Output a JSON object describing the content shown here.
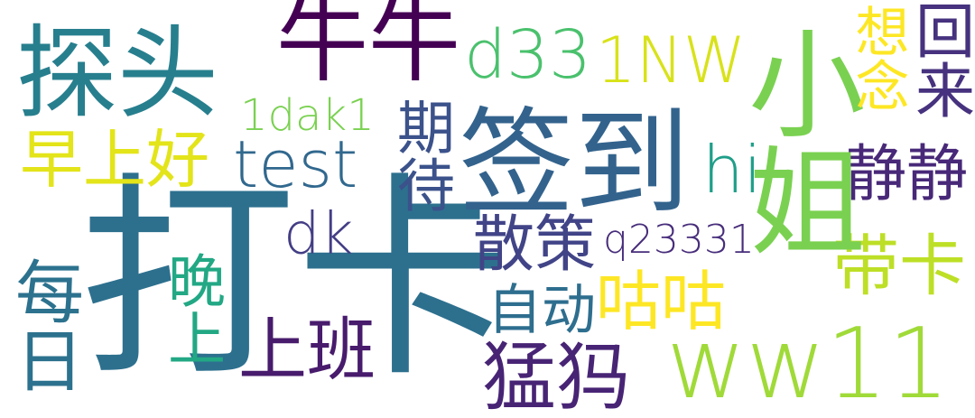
{
  "words": [
    {
      "id": "w-daka",
      "text": "打卡",
      "color": "#2d708e"
    },
    {
      "id": "w-qiandao",
      "text": "签到",
      "color": "#33638d"
    },
    {
      "id": "w-tantou",
      "text": "探头",
      "color": "#277f8e"
    },
    {
      "id": "w-niuniu",
      "text": "牛牛",
      "color": "#440154"
    },
    {
      "id": "w-xiaojie",
      "text": "小姐",
      "color": "#7ad151"
    },
    {
      "id": "w-ww11",
      "text": "ww11",
      "color": "#a0da39"
    },
    {
      "id": "w-d33",
      "text": "d33",
      "color": "#4ac16d"
    },
    {
      "id": "w-1nw",
      "text": "1NW",
      "color": "#d8e219"
    },
    {
      "id": "w-zaoshanghao",
      "text": "早上好",
      "color": "#e3e419"
    },
    {
      "id": "w-test",
      "text": "test",
      "color": "#31688e"
    },
    {
      "id": "w-1dak1",
      "text": "1dak1",
      "color": "#7ad151"
    },
    {
      "id": "w-qidai",
      "text": "期待",
      "color": "#3b528b"
    },
    {
      "id": "w-hi",
      "text": "hi",
      "color": "#1f9e89"
    },
    {
      "id": "w-xiangnian",
      "text": "想念",
      "color": "#fde725"
    },
    {
      "id": "w-huilai",
      "text": "回来",
      "color": "#46327e"
    },
    {
      "id": "w-jingjing",
      "text": "静静",
      "color": "#482878"
    },
    {
      "id": "w-dk",
      "text": "dk",
      "color": "#433e85"
    },
    {
      "id": "w-sance",
      "text": "散策",
      "color": "#414487"
    },
    {
      "id": "w-q23331",
      "text": "q23331",
      "color": "#472d7b"
    },
    {
      "id": "w-daika",
      "text": "带卡",
      "color": "#bddf26"
    },
    {
      "id": "w-meiri",
      "text": "每日",
      "color": "#2c728e"
    },
    {
      "id": "w-zidong",
      "text": "自动",
      "color": "#2e6e8e"
    },
    {
      "id": "w-wanshang",
      "text": "晚上",
      "color": "#22a884"
    },
    {
      "id": "w-gugu",
      "text": "咕咕",
      "color": "#fde725"
    },
    {
      "id": "w-shangban",
      "text": "上班",
      "color": "#481b6d"
    },
    {
      "id": "w-mengma",
      "text": "猛犸",
      "color": "#482475"
    }
  ]
}
